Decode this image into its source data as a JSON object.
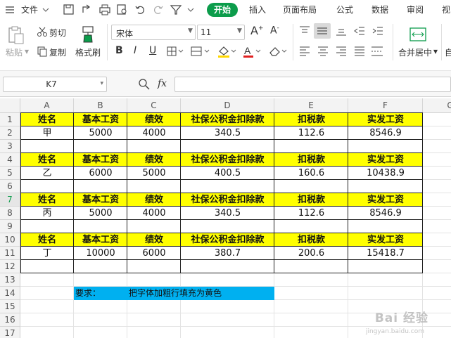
{
  "menubar": {
    "file": "文件",
    "tabs": [
      "开始",
      "插入",
      "页面布局",
      "公式",
      "数据",
      "审阅",
      "视"
    ]
  },
  "ribbon": {
    "paste": "粘贴",
    "cut": "剪切",
    "copy": "复制",
    "format_painter": "格式刷",
    "font_name": "宋体",
    "font_size": "11",
    "merge_center": "合并居中",
    "auto_wrap": "自"
  },
  "formula_bar": {
    "cell_ref": "K7",
    "fx": "fx",
    "value": ""
  },
  "sheet": {
    "columns": [
      "A",
      "B",
      "C",
      "D",
      "E",
      "F",
      "G"
    ],
    "rows": [
      "1",
      "2",
      "3",
      "4",
      "5",
      "6",
      "7",
      "8",
      "9",
      "10",
      "11",
      "12",
      "13",
      "14",
      "15",
      "16",
      "17"
    ],
    "headers": [
      "姓名",
      "基本工资",
      "绩效",
      "社保公积金扣除款",
      "扣税款",
      "实发工资"
    ],
    "records": [
      [
        "甲",
        "5000",
        "4000",
        "340.5",
        "112.6",
        "8546.9"
      ],
      [
        "乙",
        "6000",
        "5000",
        "400.5",
        "160.6",
        "10438.9"
      ],
      [
        "丙",
        "5000",
        "4000",
        "340.5",
        "112.6",
        "8546.9"
      ],
      [
        "丁",
        "10000",
        "6000",
        "380.7",
        "200.6",
        "15418.7"
      ]
    ],
    "note_label": "要求：",
    "note_text": "把字体加粗行填充为黄色"
  },
  "colors": {
    "yellow": "#ffff00",
    "cyan": "#00b0f0",
    "accent": "#0c9c4b"
  },
  "watermark": {
    "main": "Bai 经验",
    "sub": "jingyan.baidu.com"
  }
}
